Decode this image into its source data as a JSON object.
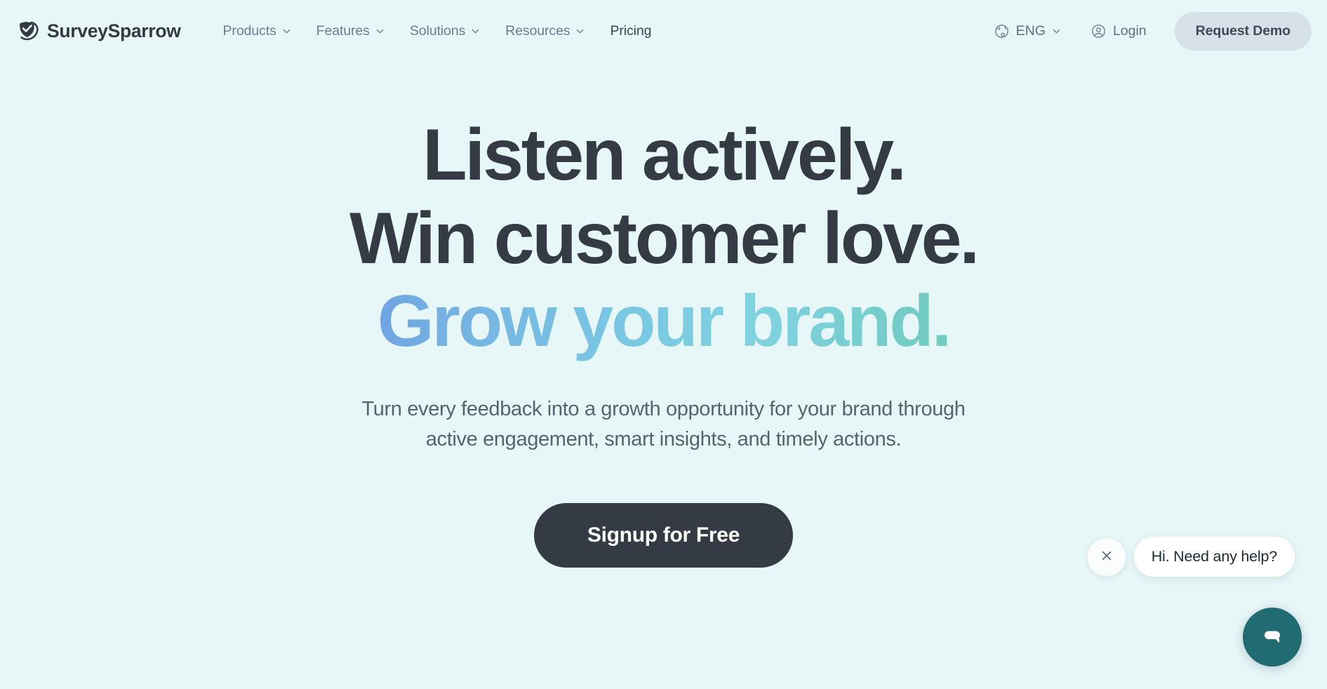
{
  "page": {
    "background_color": "#e7f6f7"
  },
  "header": {
    "brand": {
      "name": "SurveySparrow",
      "logo_icon": "sparrow-shield-check-icon",
      "color": "#343a44"
    },
    "nav_items": [
      {
        "label": "Products",
        "has_dropdown": true,
        "icon": "chevron-down-icon"
      },
      {
        "label": "Features",
        "has_dropdown": true,
        "icon": "chevron-down-icon"
      },
      {
        "label": "Solutions",
        "has_dropdown": true,
        "icon": "chevron-down-icon"
      },
      {
        "label": "Resources",
        "has_dropdown": true,
        "icon": "chevron-down-icon"
      },
      {
        "label": "Pricing",
        "has_dropdown": false,
        "icon": ""
      }
    ],
    "language": {
      "label": "ENG",
      "icon": "globe-icon",
      "dropdown_icon": "chevron-down-icon"
    },
    "login": {
      "label": "Login",
      "icon": "user-circle-icon"
    },
    "demo_button": {
      "label": "Request Demo",
      "background_color": "#d7e1e9",
      "text_color": "#3e4a58"
    }
  },
  "hero": {
    "title_lines": [
      "Listen actively.",
      "Win customer love.",
      "Grow your brand."
    ],
    "title_color": "#343b45",
    "gradient_line_index": 2,
    "gradient_colors": [
      "#5c63e8",
      "#74b1e2",
      "#7fd3e0",
      "#6ec9a6",
      "#74cc6e"
    ],
    "subtitle_lines": [
      "Turn every feedback into a growth opportunity for your brand through",
      "active engagement, smart insights, and timely actions."
    ],
    "subtitle_color": "#566370",
    "cta": {
      "label": "Signup for Free",
      "background_color": "#343b45",
      "text_color": "#ffffff"
    }
  },
  "chat_widget": {
    "close_icon": "close-x-icon",
    "message": "Hi. Need any help?",
    "launcher_icon": "chat-bubble-icon",
    "launcher_color": "#216c72"
  }
}
